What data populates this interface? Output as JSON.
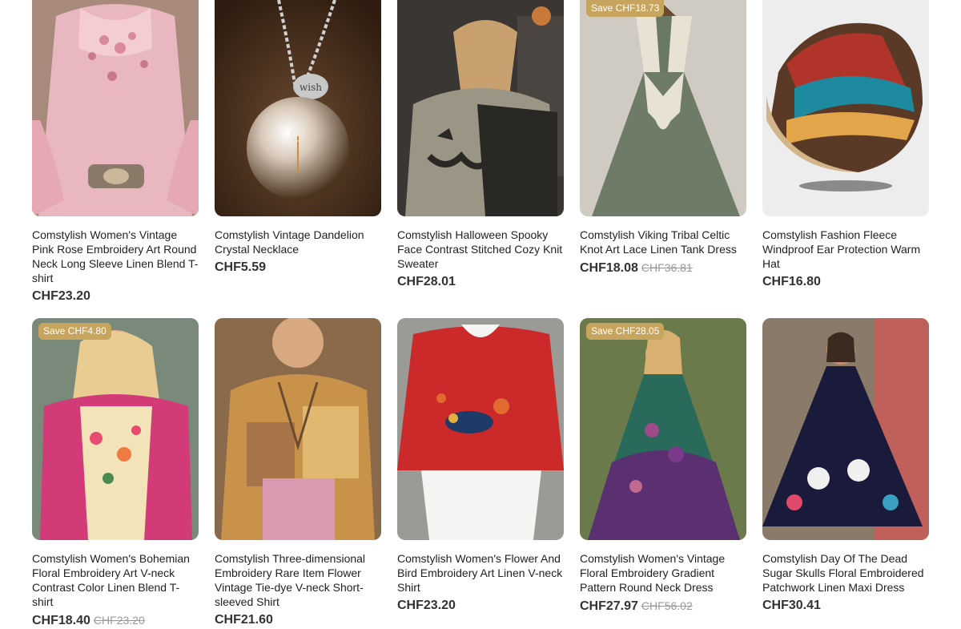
{
  "products": [
    {
      "title": "Comstylish Women's Vintage Pink Rose Embroidery Art Round Neck Long Sleeve Linen Blend T-shirt",
      "price": "CHF23.20",
      "old_price": "",
      "badge": ""
    },
    {
      "title": "Comstylish Vintage Dandelion Crystal Necklace",
      "price": "CHF5.59",
      "old_price": "",
      "badge": ""
    },
    {
      "title": "Comstylish Halloween Spooky Face Contrast Stitched Cozy Knit Sweater",
      "price": "CHF28.01",
      "old_price": "",
      "badge": ""
    },
    {
      "title": "Comstylish Viking Tribal Celtic Knot Art Lace Linen Tank Dress",
      "price": "CHF18.08",
      "old_price": "CHF36.81",
      "badge": "Save CHF18.73"
    },
    {
      "title": "Comstylish Fashion Fleece Windproof Ear Protection Warm Hat",
      "price": "CHF16.80",
      "old_price": "",
      "badge": ""
    },
    {
      "title": "Comstylish Women's Bohemian Floral Embroidery Art V-neck Contrast Color Linen Blend T-shirt",
      "price": "CHF18.40",
      "old_price": "CHF23.20",
      "badge": "Save CHF4.80"
    },
    {
      "title": "Comstylish Three-dimensional Embroidery Rare Item Flower Vintage Tie-dye V-neck Short-sleeved Shirt",
      "price": "CHF21.60",
      "old_price": "",
      "badge": ""
    },
    {
      "title": "Comstylish Women's Flower And Bird Embroidery Art Linen V-neck Shirt",
      "price": "CHF23.20",
      "old_price": "",
      "badge": ""
    },
    {
      "title": "Comstylish Women's Vintage Floral Embroidery Gradient Pattern Round Neck Dress",
      "price": "CHF27.97",
      "old_price": "CHF56.02",
      "badge": "Save CHF28.05"
    },
    {
      "title": "Comstylish Day Of The Dead Sugar Skulls Floral Embroidered Patchwork Linen Maxi Dress",
      "price": "CHF30.41",
      "old_price": "",
      "badge": ""
    }
  ],
  "colors": {
    "badge": "#c8a55e",
    "old_price": "#999999",
    "price": "#333333"
  }
}
